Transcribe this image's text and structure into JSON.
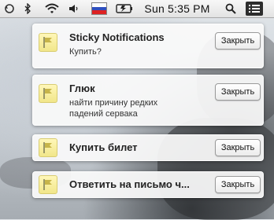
{
  "menubar": {
    "clock": "Sun 5:35 PM",
    "icons": [
      "sync-icon",
      "bluetooth-icon",
      "wifi-icon",
      "volume-icon",
      "input-flag-icon",
      "battery-icon",
      "search-icon",
      "list-icon"
    ]
  },
  "notifications": [
    {
      "title": "Sticky Notifications",
      "body": "Купить?",
      "button": "Закрыть"
    },
    {
      "title": "Глюк",
      "body": "найти причину редких падений сервака",
      "button": "Закрыть"
    },
    {
      "title": "Купить билет",
      "body": "",
      "button": "Закрыть"
    },
    {
      "title": "Ответить на письмо ч...",
      "body": "",
      "button": "Закрыть"
    }
  ]
}
